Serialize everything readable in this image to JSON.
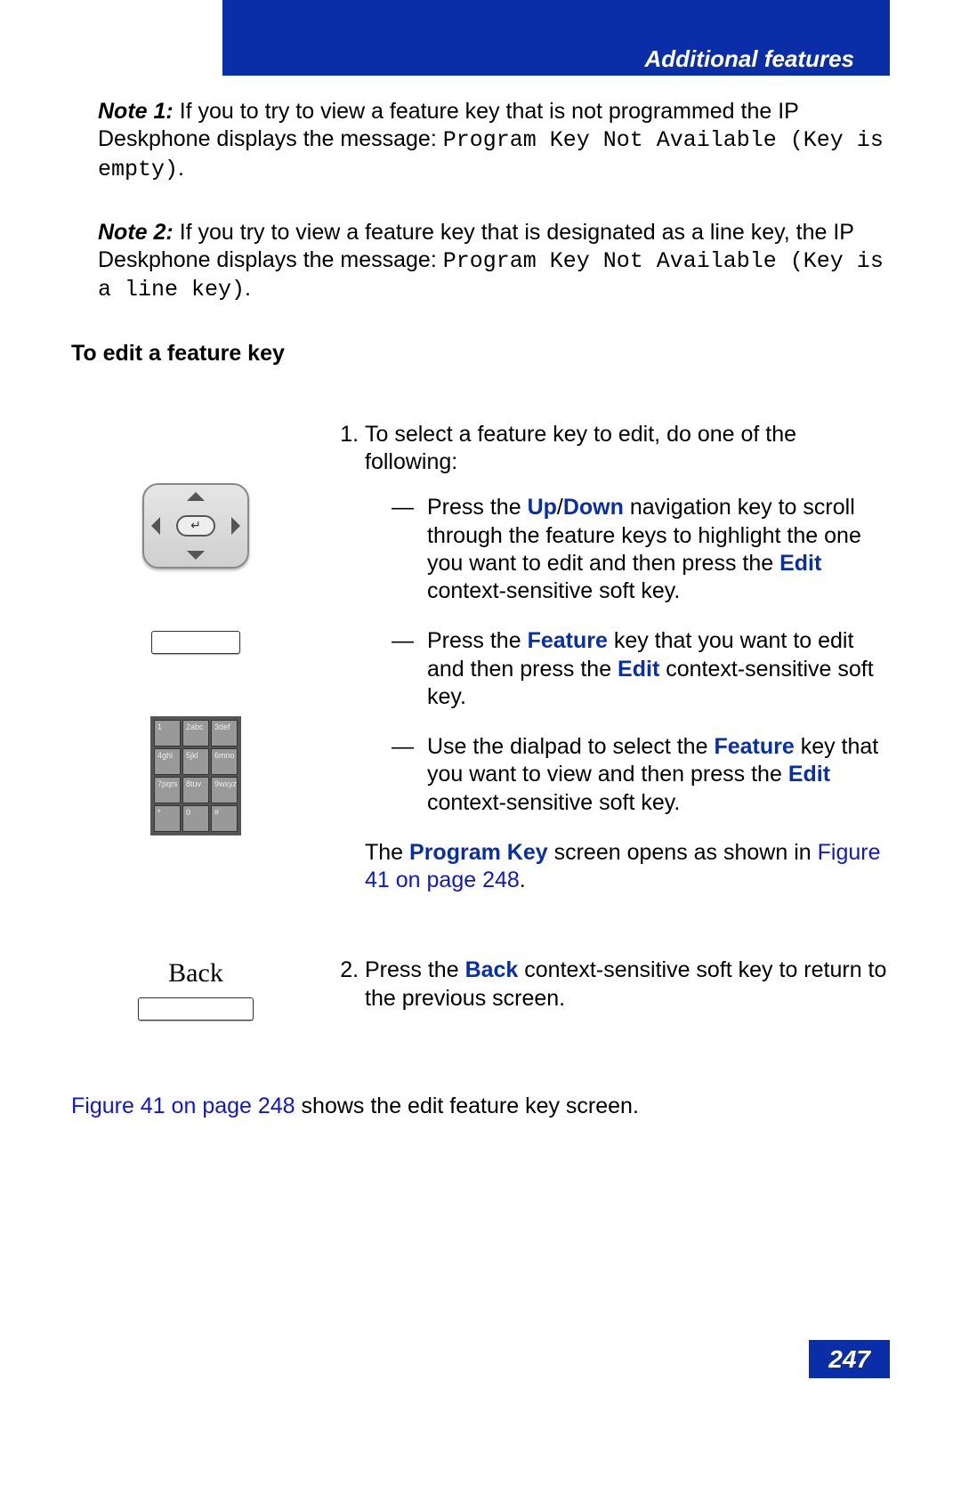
{
  "header": {
    "title": "Additional features"
  },
  "notes": {
    "n1": {
      "label": "Note 1:",
      "text_a": "If you to try to view a feature key that is not programmed the IP Deskphone displays the message: ",
      "code": "Program Key Not Available (Key is empty)",
      "text_b": "."
    },
    "n2": {
      "label": "Note 2:",
      "text_a": "If you try to view a feature key that is designated as a line key, the IP Deskphone displays the message: ",
      "code": "Program Key Not Available (Key is a line key)",
      "text_b": "."
    }
  },
  "section_title": "To edit a feature key",
  "step1": {
    "lead": "To select a feature key to edit, do one of the following:",
    "a": {
      "t1": "Press the ",
      "kw1": "Up",
      "slash": "/",
      "kw2": "Down",
      "t2": " navigation key to scroll through the feature keys to highlight the one you want to edit and then press the ",
      "kw3": "Edit",
      "t3": " context-sensitive soft key."
    },
    "b": {
      "t1": "Press the ",
      "kw1": "Feature",
      "t2": " key that you want to edit and then press the ",
      "kw2": "Edit",
      "t3": " context-sensitive soft key."
    },
    "c": {
      "t1": "Use the dialpad to select the ",
      "kw1": "Feature",
      "t2": " key that you want to view and then press the ",
      "kw2": "Edit",
      "t3": " context-sensitive soft key."
    },
    "result": {
      "t1": "The ",
      "kw": "Program Key",
      "t2": " screen opens as shown in ",
      "link": "Figure 41 on page 248",
      "t3": "."
    }
  },
  "step2": {
    "t1": "Press the ",
    "kw": "Back",
    "t2": " context-sensitive soft key to return to the previous screen."
  },
  "back_label": "Back",
  "footer": {
    "link": "Figure 41 on page 248",
    "rest": " shows the edit feature key screen."
  },
  "page_number": "247",
  "dialpad_keys": [
    "1",
    "2abc",
    "3def",
    "4ghi",
    "5jkl",
    "6mno",
    "7pqrs",
    "8tuv",
    "9wxyz",
    "*",
    "0",
    "#"
  ]
}
